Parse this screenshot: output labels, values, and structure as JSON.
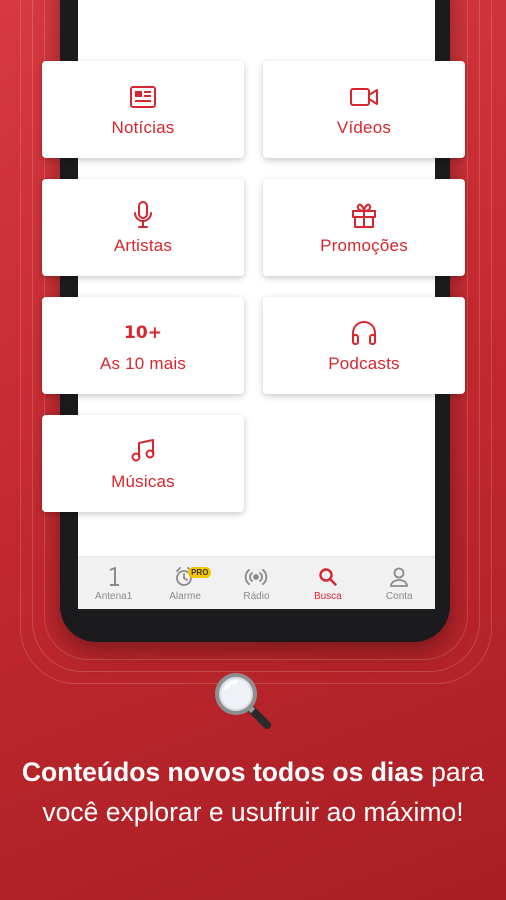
{
  "grid": {
    "items": [
      {
        "id": "noticias",
        "label": "Notícias",
        "icon": "newspaper-icon"
      },
      {
        "id": "videos",
        "label": "Vídeos",
        "icon": "video-camera-icon"
      },
      {
        "id": "artistas",
        "label": "Artistas",
        "icon": "microphone-icon"
      },
      {
        "id": "promocoes",
        "label": "Promoções",
        "icon": "gift-icon"
      },
      {
        "id": "top10",
        "label": "As 10 mais",
        "icon": "ten-plus-icon",
        "icon_text": "10+"
      },
      {
        "id": "podcasts",
        "label": "Podcasts",
        "icon": "headphones-icon"
      },
      {
        "id": "musicas",
        "label": "Músicas",
        "icon": "music-note-icon"
      }
    ]
  },
  "tabbar": {
    "items": [
      {
        "label": "Antena1",
        "icon": "antena1-logo-icon",
        "active": false
      },
      {
        "label": "Alarme",
        "icon": "alarm-clock-icon",
        "active": false,
        "badge": "PRO"
      },
      {
        "label": "Rádio",
        "icon": "radio-broadcast-icon",
        "active": false
      },
      {
        "label": "Busca",
        "icon": "search-icon",
        "active": true
      },
      {
        "label": "Conta",
        "icon": "user-icon",
        "active": false
      }
    ]
  },
  "promo": {
    "headline_bold": "Conteúdos novos todos os dias",
    "headline_rest": " para você explorar e usufruir ao máximo!"
  },
  "colors": {
    "accent": "#d7262f",
    "background": "#c42a30",
    "inactive_tab": "#8a8a8a",
    "badge": "#f5c400"
  }
}
